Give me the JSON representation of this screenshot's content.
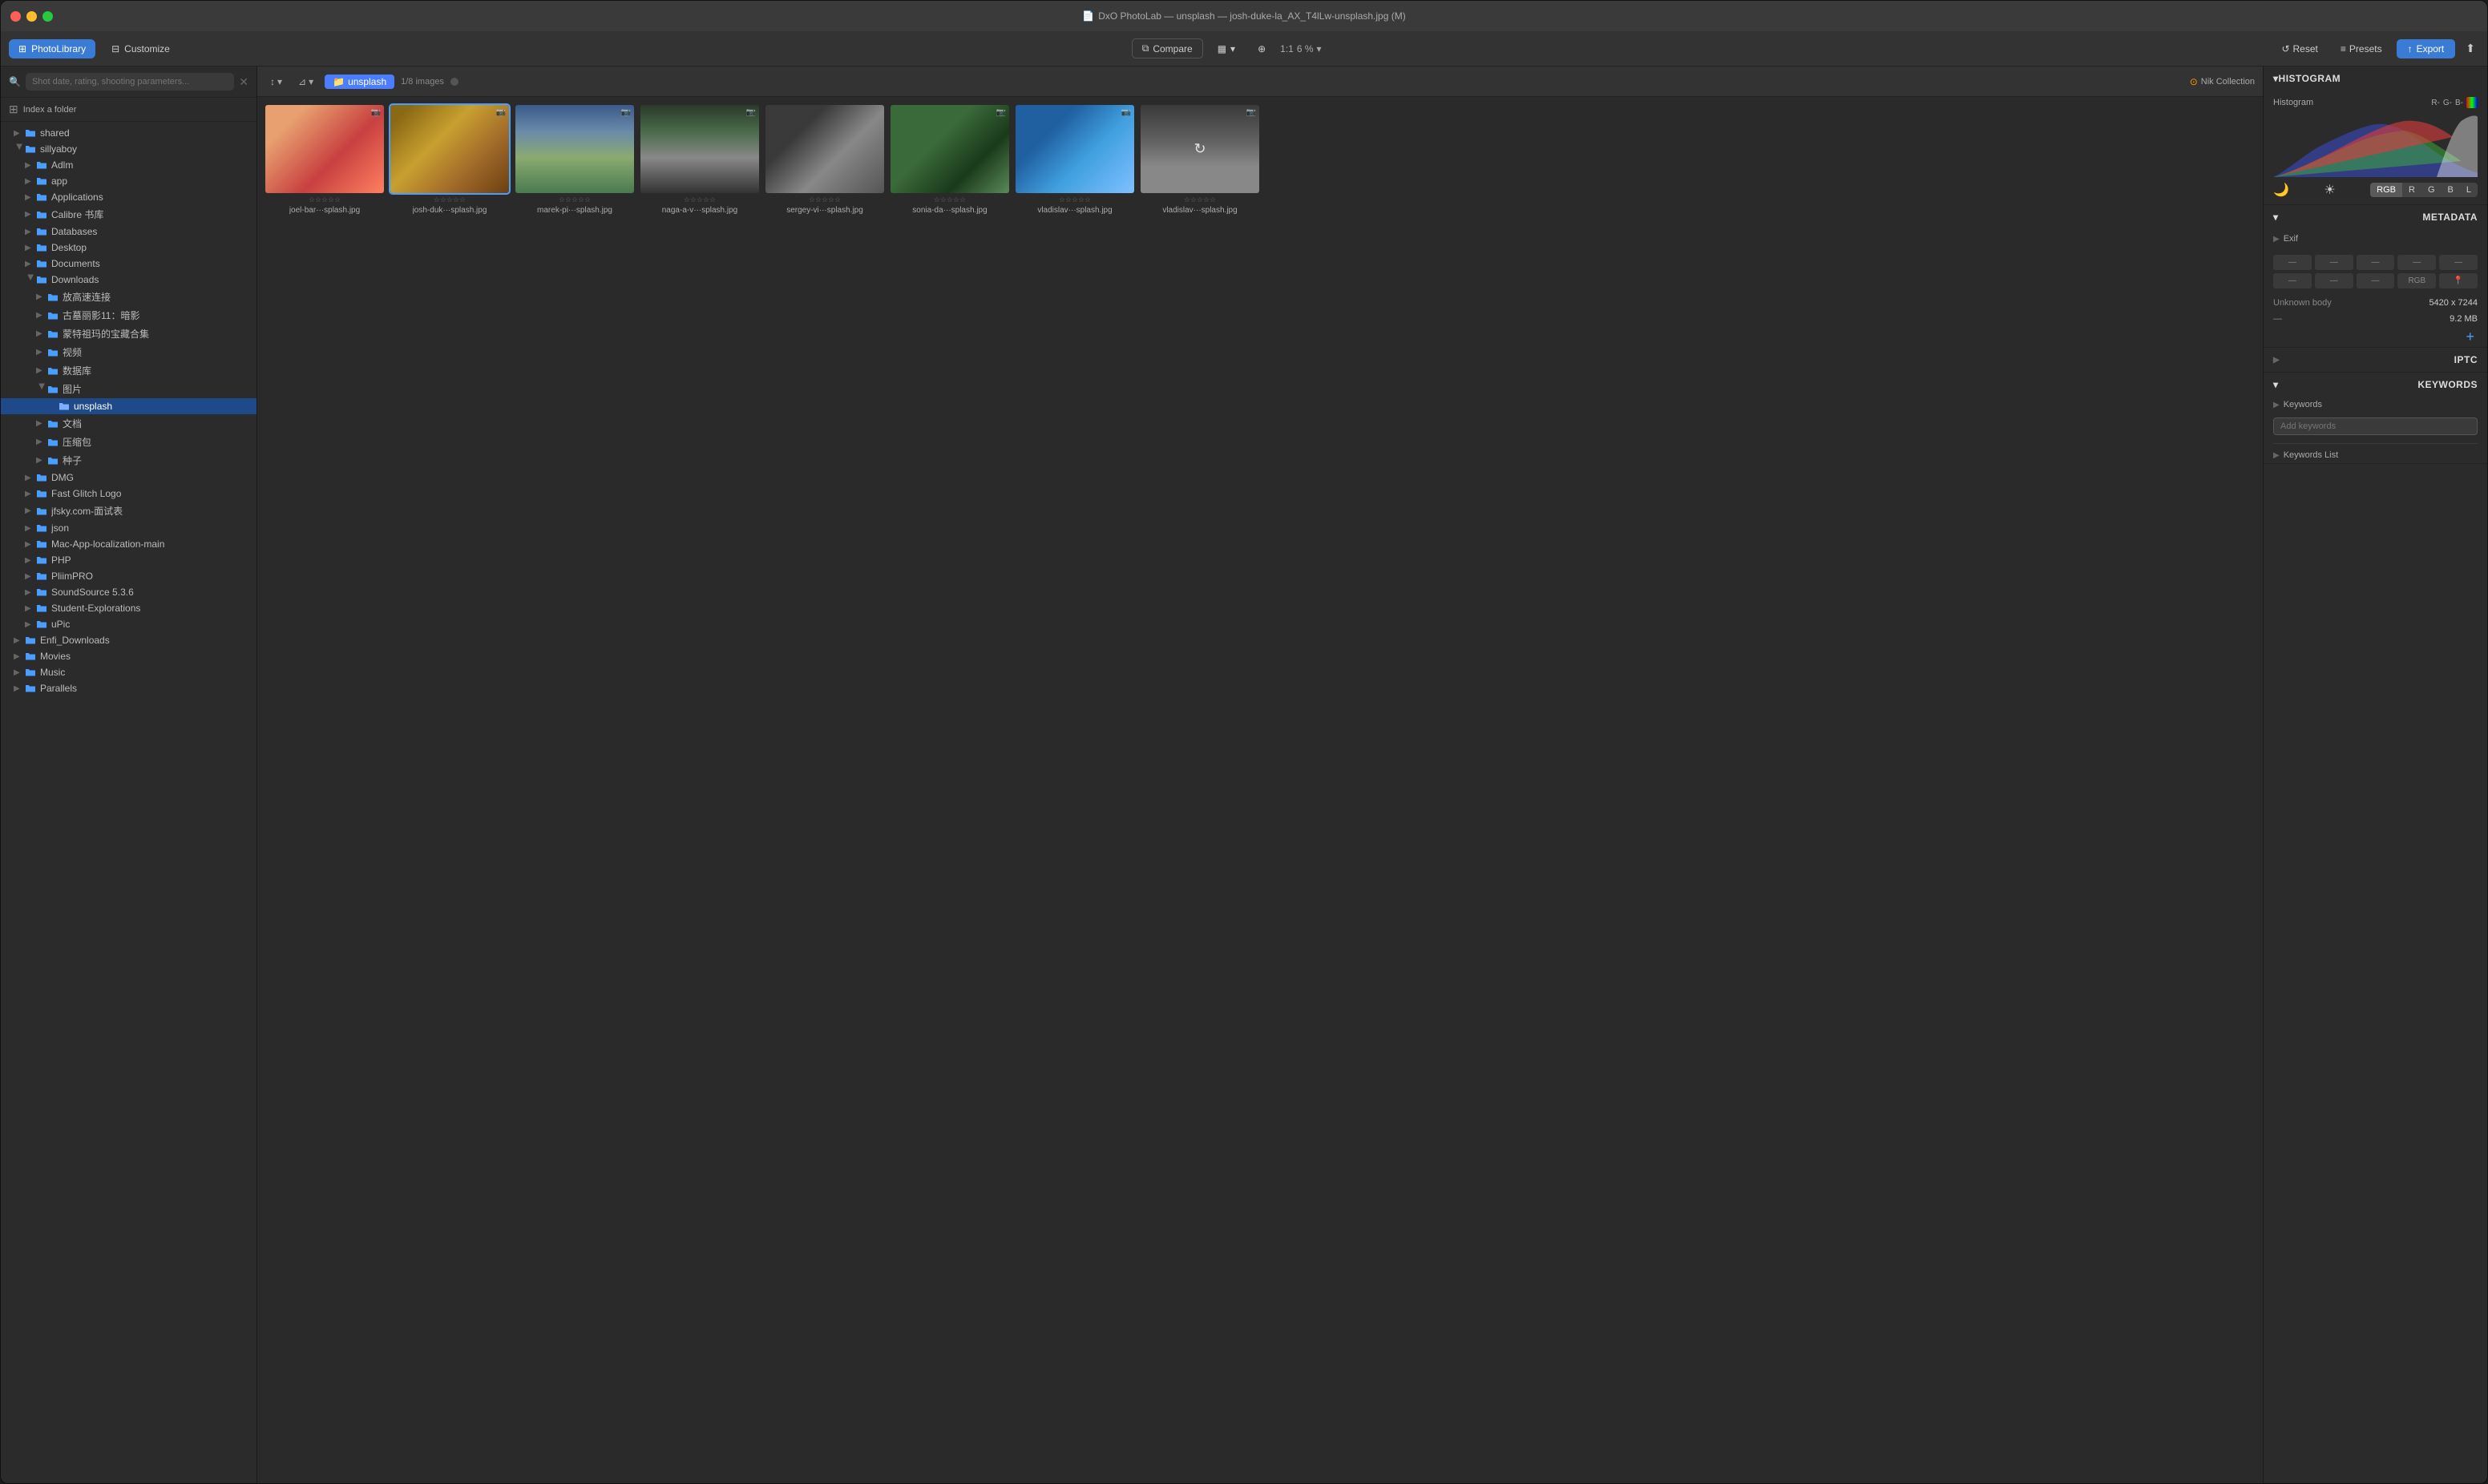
{
  "window": {
    "title": "DxO PhotoLab — unsplash — josh-duke-la_AX_T4lLw-unsplash.jpg (M)"
  },
  "toolbar": {
    "photolibrary_label": "PhotoLibrary",
    "customize_label": "Customize",
    "compare_label": "Compare",
    "zoom_fit": "1:1",
    "zoom_percent": "6 %",
    "reset_label": "Reset",
    "presets_label": "Presets",
    "export_label": "Export"
  },
  "photo_toolbar": {
    "folder_name": "unsplash",
    "image_count": "1/8 images",
    "nik_label": "Nik Collection"
  },
  "sidebar": {
    "search_placeholder": "Shot date, rating, shooting parameters...",
    "index_folder": "Index a folder",
    "items": [
      {
        "label": "shared",
        "indent": 1,
        "expanded": false,
        "color": "blue"
      },
      {
        "label": "sillyaboy",
        "indent": 1,
        "expanded": true,
        "color": "blue"
      },
      {
        "label": "Adlm",
        "indent": 2,
        "expanded": false,
        "color": "blue"
      },
      {
        "label": "app",
        "indent": 2,
        "expanded": false,
        "color": "blue"
      },
      {
        "label": "Applications",
        "indent": 2,
        "expanded": false,
        "color": "blue"
      },
      {
        "label": "Calibre 书库",
        "indent": 2,
        "expanded": false,
        "color": "blue"
      },
      {
        "label": "Databases",
        "indent": 2,
        "expanded": false,
        "color": "blue"
      },
      {
        "label": "Desktop",
        "indent": 2,
        "expanded": false,
        "color": "blue"
      },
      {
        "label": "Documents",
        "indent": 2,
        "expanded": false,
        "color": "blue"
      },
      {
        "label": "Downloads",
        "indent": 2,
        "expanded": true,
        "color": "blue"
      },
      {
        "label": "放高速连接",
        "indent": 3,
        "expanded": false,
        "color": "blue"
      },
      {
        "label": "古墓丽影11：暗影",
        "indent": 3,
        "expanded": false,
        "color": "blue"
      },
      {
        "label": "蒙特祖玛的宝藏合集",
        "indent": 3,
        "expanded": false,
        "color": "blue"
      },
      {
        "label": "视频",
        "indent": 3,
        "expanded": false,
        "color": "blue"
      },
      {
        "label": "数据库",
        "indent": 3,
        "expanded": false,
        "color": "blue"
      },
      {
        "label": "图片",
        "indent": 3,
        "expanded": true,
        "color": "blue"
      },
      {
        "label": "unsplash",
        "indent": 4,
        "expanded": false,
        "color": "blue",
        "selected": true
      },
      {
        "label": "文档",
        "indent": 3,
        "expanded": false,
        "color": "blue"
      },
      {
        "label": "压缩包",
        "indent": 3,
        "expanded": false,
        "color": "blue"
      },
      {
        "label": "种子",
        "indent": 3,
        "expanded": false,
        "color": "blue"
      },
      {
        "label": "DMG",
        "indent": 2,
        "expanded": false,
        "color": "blue"
      },
      {
        "label": "Fast Glitch Logo",
        "indent": 2,
        "expanded": false,
        "color": "blue"
      },
      {
        "label": "jfsky.com-面试表",
        "indent": 2,
        "expanded": false,
        "color": "blue"
      },
      {
        "label": "json",
        "indent": 2,
        "expanded": false,
        "color": "blue"
      },
      {
        "label": "Mac-App-localization-main",
        "indent": 2,
        "expanded": false,
        "color": "blue"
      },
      {
        "label": "PHP",
        "indent": 2,
        "expanded": false,
        "color": "blue"
      },
      {
        "label": "PliimPRO",
        "indent": 2,
        "expanded": false,
        "color": "blue"
      },
      {
        "label": "SoundSource 5.3.6",
        "indent": 2,
        "expanded": false,
        "color": "blue"
      },
      {
        "label": "Student-Explorations",
        "indent": 2,
        "expanded": false,
        "color": "blue"
      },
      {
        "label": "uPic",
        "indent": 2,
        "expanded": false,
        "color": "blue"
      },
      {
        "label": "Enfi_Downloads",
        "indent": 1,
        "expanded": false,
        "color": "blue"
      },
      {
        "label": "Movies",
        "indent": 1,
        "expanded": false,
        "color": "blue"
      },
      {
        "label": "Music",
        "indent": 1,
        "expanded": false,
        "color": "blue"
      },
      {
        "label": "Parallels",
        "indent": 1,
        "expanded": false,
        "color": "blue"
      }
    ]
  },
  "photos": [
    {
      "id": 1,
      "label": "joel-bar···splash.jpg",
      "thumb_class": "thumb-1",
      "has_camera": true,
      "stars": "★★★★★"
    },
    {
      "id": 2,
      "label": "josh-duk···splash.jpg",
      "thumb_class": "thumb-2",
      "has_camera": true,
      "stars": "★★★★★",
      "selected": true
    },
    {
      "id": 3,
      "label": "marek-pi···splash.jpg",
      "thumb_class": "thumb-3",
      "has_camera": true,
      "stars": "★★★★★"
    },
    {
      "id": 4,
      "label": "naga-a-v···splash.jpg",
      "thumb_class": "thumb-4",
      "has_camera": true,
      "stars": "★★★★★"
    },
    {
      "id": 5,
      "label": "sergey-vi···splash.jpg",
      "thumb_class": "thumb-5",
      "has_camera": false,
      "stars": "★★★★★"
    },
    {
      "id": 6,
      "label": "sonia-da···splash.jpg",
      "thumb_class": "thumb-6",
      "has_camera": true,
      "stars": "★★★★★"
    },
    {
      "id": 7,
      "label": "vladislav···splash.jpg",
      "thumb_class": "thumb-7",
      "has_camera": true,
      "stars": "★★★★★"
    },
    {
      "id": 8,
      "label": "vladislav···splash.jpg",
      "thumb_class": "thumb-8",
      "has_camera": true,
      "stars": "★★★★★",
      "loading": true
    }
  ],
  "right_panel": {
    "histogram_section": "HISTOGRAM",
    "histogram_label": "Histogram",
    "channel_labels": "R- G- B-",
    "metadata_section": "METADATA",
    "exif_section": "Exif",
    "meta_cells": [
      "—",
      "—",
      "—",
      "—",
      "—",
      "—",
      "—",
      "—",
      "RGB",
      "📍"
    ],
    "unknown_body": "Unknown body",
    "resolution": "5420 x 7244",
    "file_dash": "—",
    "file_size": "9.2 MB",
    "iptc_section": "IPTC",
    "keywords_section": "KEYWORDS",
    "keywords_label": "Keywords",
    "keywords_list_label": "Keywords List",
    "add_keywords_placeholder": "Add keywords"
  },
  "rgb_buttons": [
    "RGB",
    "R",
    "G",
    "B",
    "L"
  ]
}
